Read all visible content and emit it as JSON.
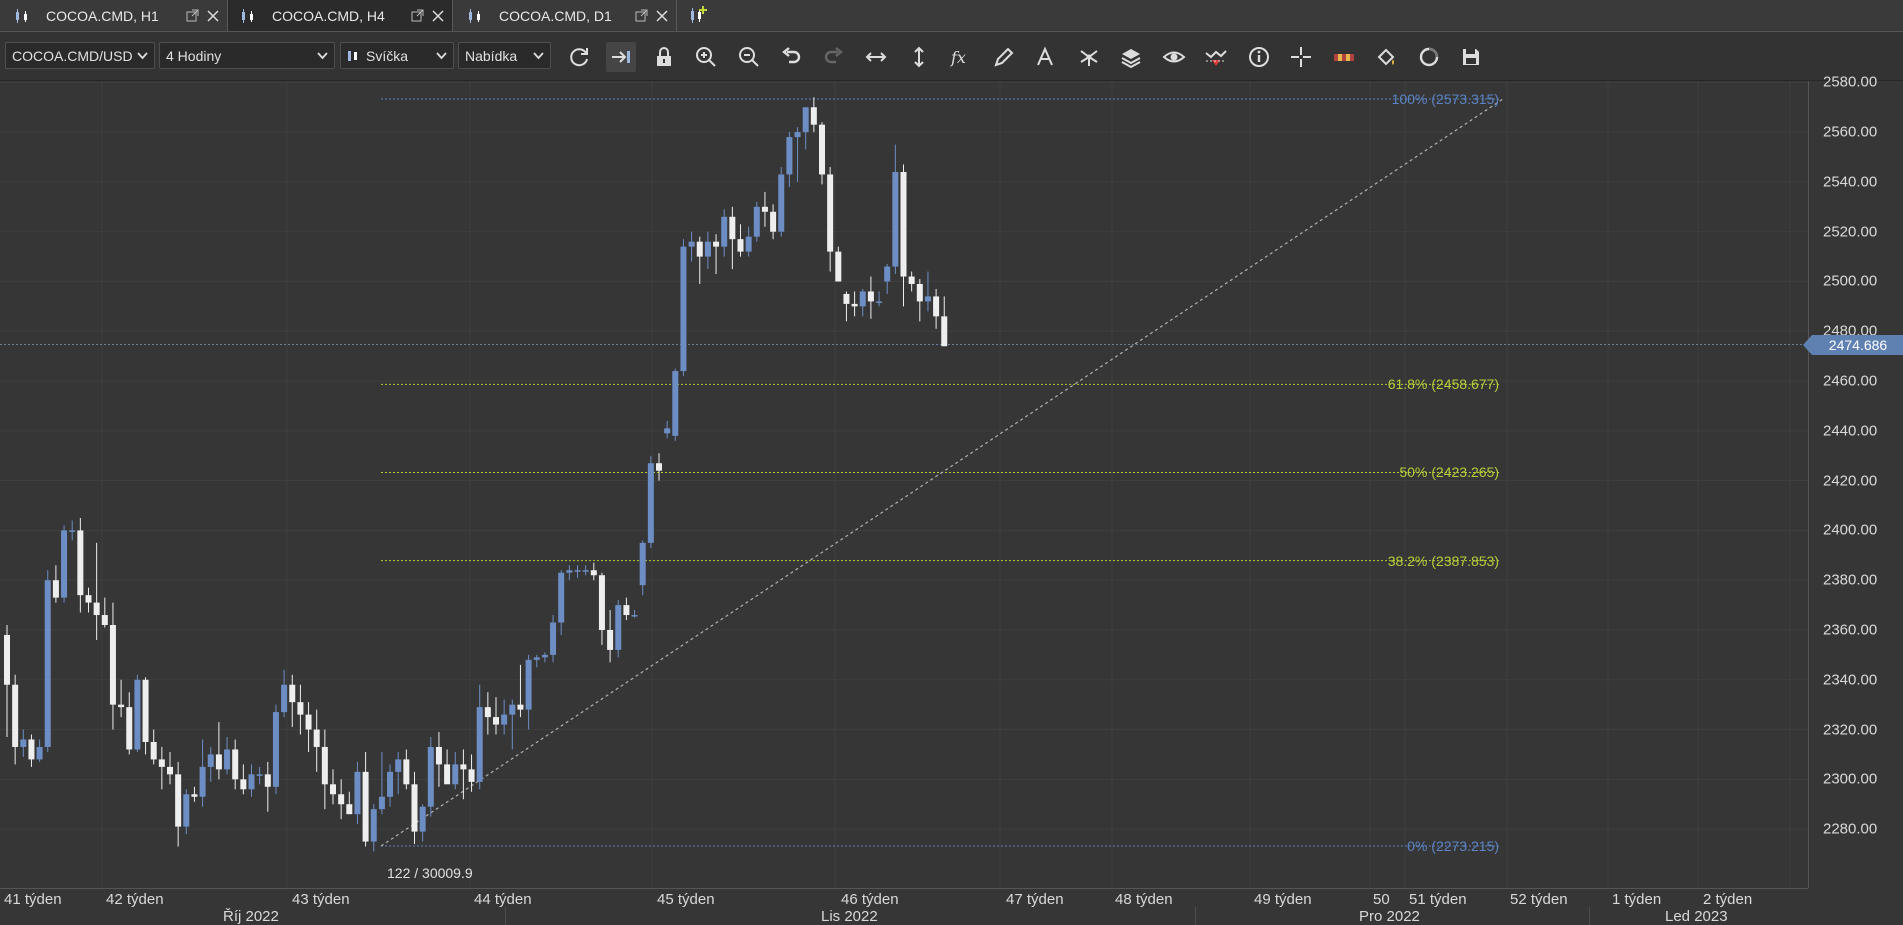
{
  "tabs": [
    {
      "label": "COCOA.CMD, H1",
      "active": false
    },
    {
      "label": "COCOA.CMD, H4",
      "active": true
    },
    {
      "label": "COCOA.CMD, D1",
      "active": false
    }
  ],
  "toolbar": {
    "instrument": "COCOA.CMD/USD",
    "period": "4 Hodiny",
    "chart_type": "Svíčka",
    "side": "Nabídka",
    "buttons": [
      "refresh-icon",
      "shift-chart-icon",
      "lock-icon",
      "zoom-in-icon",
      "zoom-out-icon",
      "undo-icon",
      "redo-icon",
      "horizontal-scale-icon",
      "vertical-scale-icon",
      "indicators-fx-icon",
      "drawing-pencil-icon",
      "text-tool-icon",
      "patterns-icon",
      "layers-icon",
      "visibility-eye-icon",
      "alerts-icon",
      "info-icon",
      "crosshair-icon",
      "ruler-icon",
      "theme-icon",
      "templates-icon",
      "save-icon"
    ]
  },
  "colors": {
    "background": "#363636",
    "bull_candle": "#6d8ec4",
    "bear_candle": "#eeeeee",
    "fib_blue": "#5b84c4",
    "fib_green": "#b9cc3a",
    "price_tag": "#5f81b2"
  },
  "price_axis": {
    "labels": [
      "2580.00",
      "2560.00",
      "2540.00",
      "2520.00",
      "2500.00",
      "2480.00",
      "2460.00",
      "2440.00",
      "2420.00",
      "2400.00",
      "2380.00",
      "2360.00",
      "2340.00",
      "2320.00",
      "2300.00",
      "2280.00"
    ],
    "current_price": "2474.686"
  },
  "time_axis": {
    "weeks": [
      "41 týden",
      "42 týden",
      "43 týden",
      "44 týden",
      "45 týden",
      "46 týden",
      "47 týden",
      "48 týden",
      "49 týden",
      "50",
      "51 týden",
      "52 týden",
      "1 týden",
      "2 týden"
    ],
    "months": [
      "Říj 2022",
      "Lis 2022",
      "Pro 2022",
      "Led 2023"
    ]
  },
  "fibonacci": {
    "levels": [
      {
        "label": "100% (2573.315)",
        "price": 2573.315,
        "color": "blue"
      },
      {
        "label": "61.8% (2458.677)",
        "price": 2458.677,
        "color": "green"
      },
      {
        "label": "50% (2423.265)",
        "price": 2423.265,
        "color": "green"
      },
      {
        "label": "38.2% (2387.853)",
        "price": 2387.853,
        "color": "green"
      },
      {
        "label": "0% (2273.215)",
        "price": 2273.215,
        "color": "blue"
      }
    ]
  },
  "info_text": "122 / 30009.9",
  "candles": [
    [
      2358,
      2362,
      2317,
      2338
    ],
    [
      2338,
      2342,
      2306,
      2313
    ],
    [
      2313,
      2320,
      2309,
      2316
    ],
    [
      2316,
      2318,
      2305,
      2308
    ],
    [
      2308,
      2316,
      2307,
      2313
    ],
    [
      2313,
      2384,
      2311,
      2380
    ],
    [
      2380,
      2386,
      2371,
      2373
    ],
    [
      2373,
      2402,
      2371,
      2400
    ],
    [
      2400,
      2404,
      2396,
      2400
    ],
    [
      2400,
      2405,
      2367,
      2374
    ],
    [
      2374,
      2377,
      2367,
      2371
    ],
    [
      2371,
      2395,
      2356,
      2366
    ],
    [
      2366,
      2373,
      2361,
      2362
    ],
    [
      2362,
      2371,
      2320,
      2330
    ],
    [
      2330,
      2340,
      2325,
      2329
    ],
    [
      2329,
      2335,
      2310,
      2312
    ],
    [
      2312,
      2342,
      2311,
      2340
    ],
    [
      2340,
      2341,
      2310,
      2315
    ],
    [
      2315,
      2320,
      2306,
      2308
    ],
    [
      2308,
      2313,
      2296,
      2305
    ],
    [
      2305,
      2311,
      2298,
      2302
    ],
    [
      2302,
      2307,
      2273,
      2281
    ],
    [
      2281,
      2296,
      2278,
      2294
    ],
    [
      2294,
      2297,
      2291,
      2293
    ],
    [
      2293,
      2316,
      2289,
      2305
    ],
    [
      2305,
      2313,
      2299,
      2310
    ],
    [
      2310,
      2323,
      2300,
      2304
    ],
    [
      2304,
      2317,
      2302,
      2312
    ],
    [
      2312,
      2316,
      2296,
      2300
    ],
    [
      2300,
      2306,
      2294,
      2296
    ],
    [
      2296,
      2306,
      2293,
      2302
    ],
    [
      2302,
      2305,
      2298,
      2302
    ],
    [
      2302,
      2307,
      2287,
      2297
    ],
    [
      2297,
      2330,
      2294,
      2327
    ],
    [
      2327,
      2344,
      2325,
      2338
    ],
    [
      2338,
      2342,
      2321,
      2331
    ],
    [
      2331,
      2338,
      2318,
      2326
    ],
    [
      2326,
      2331,
      2311,
      2320
    ],
    [
      2320,
      2328,
      2303,
      2313
    ],
    [
      2313,
      2320,
      2288,
      2298
    ],
    [
      2298,
      2304,
      2290,
      2294
    ],
    [
      2294,
      2300,
      2284,
      2290
    ],
    [
      2290,
      2295,
      2286,
      2286
    ],
    [
      2286,
      2307,
      2282,
      2303
    ],
    [
      2303,
      2311,
      2273,
      2275
    ],
    [
      2275,
      2290,
      2271,
      2288
    ],
    [
      2288,
      2311,
      2286,
      2293
    ],
    [
      2293,
      2306,
      2289,
      2303
    ],
    [
      2303,
      2311,
      2294,
      2308
    ],
    [
      2308,
      2312,
      2296,
      2298
    ],
    [
      2298,
      2303,
      2274,
      2279
    ],
    [
      2279,
      2290,
      2275,
      2289
    ],
    [
      2289,
      2317,
      2285,
      2313
    ],
    [
      2313,
      2319,
      2297,
      2306
    ],
    [
      2306,
      2312,
      2299,
      2298
    ],
    [
      2298,
      2311,
      2296,
      2306
    ],
    [
      2306,
      2312,
      2292,
      2304
    ],
    [
      2304,
      2310,
      2295,
      2299
    ],
    [
      2299,
      2338,
      2296,
      2329
    ],
    [
      2329,
      2335,
      2318,
      2325
    ],
    [
      2325,
      2333,
      2318,
      2322
    ],
    [
      2322,
      2332,
      2318,
      2326
    ],
    [
      2326,
      2332,
      2312,
      2330
    ],
    [
      2330,
      2346,
      2325,
      2328
    ],
    [
      2328,
      2350,
      2320,
      2348
    ],
    [
      2348,
      2350,
      2345,
      2349
    ],
    [
      2349,
      2351,
      2347,
      2350
    ],
    [
      2350,
      2366,
      2347,
      2363
    ],
    [
      2363,
      2384,
      2358,
      2383
    ],
    [
      2383,
      2386,
      2380,
      2384
    ],
    [
      2384,
      2386,
      2381,
      2384
    ],
    [
      2384,
      2386,
      2382,
      2384
    ],
    [
      2384,
      2387,
      2380,
      2382
    ],
    [
      2382,
      2383,
      2354,
      2360
    ],
    [
      2360,
      2368,
      2347,
      2352
    ],
    [
      2352,
      2372,
      2349,
      2370
    ],
    [
      2370,
      2373,
      2364,
      2366
    ],
    [
      2366,
      2368,
      2365,
      2366
    ],
    [
      2378,
      2396,
      2374,
      2395
    ],
    [
      2395,
      2430,
      2393,
      2427
    ],
    [
      2427,
      2431,
      2420,
      2424
    ],
    [
      2439,
      2444,
      2437,
      2441
    ],
    [
      2438,
      2465,
      2436,
      2464
    ],
    [
      2464,
      2517,
      2462,
      2514
    ],
    [
      2514,
      2520,
      2508,
      2516
    ],
    [
      2516,
      2518,
      2499,
      2510
    ],
    [
      2510,
      2520,
      2505,
      2516
    ],
    [
      2516,
      2519,
      2503,
      2514
    ],
    [
      2514,
      2529,
      2510,
      2526
    ],
    [
      2526,
      2530,
      2505,
      2517
    ],
    [
      2517,
      2523,
      2510,
      2512
    ],
    [
      2512,
      2522,
      2510,
      2518
    ],
    [
      2518,
      2532,
      2516,
      2530
    ],
    [
      2530,
      2536,
      2522,
      2528
    ],
    [
      2528,
      2531,
      2517,
      2520
    ],
    [
      2520,
      2546,
      2518,
      2543
    ],
    [
      2543,
      2560,
      2538,
      2558
    ],
    [
      2558,
      2562,
      2540,
      2560
    ],
    [
      2560,
      2568,
      2553,
      2570
    ],
    [
      2570,
      2574,
      2560,
      2563
    ],
    [
      2563,
      2564,
      2539,
      2543
    ],
    [
      2543,
      2546,
      2504,
      2512
    ],
    [
      2512,
      2514,
      2500,
      2500
    ],
    [
      2495,
      2496,
      2484,
      2491
    ],
    [
      2491,
      2496,
      2486,
      2490
    ],
    [
      2490,
      2497,
      2486,
      2496
    ],
    [
      2496,
      2502,
      2485,
      2492
    ],
    [
      2492,
      2496,
      2490,
      2492
    ],
    [
      2500,
      2507,
      2495,
      2506
    ],
    [
      2506,
      2555,
      2503,
      2544
    ],
    [
      2544,
      2547,
      2490,
      2502
    ],
    [
      2502,
      2504,
      2496,
      2499
    ],
    [
      2499,
      2501,
      2484,
      2492
    ],
    [
      2492,
      2504,
      2488,
      2494
    ],
    [
      2494,
      2497,
      2481,
      2486
    ],
    [
      2486,
      2494,
      2474,
      2474
    ]
  ]
}
